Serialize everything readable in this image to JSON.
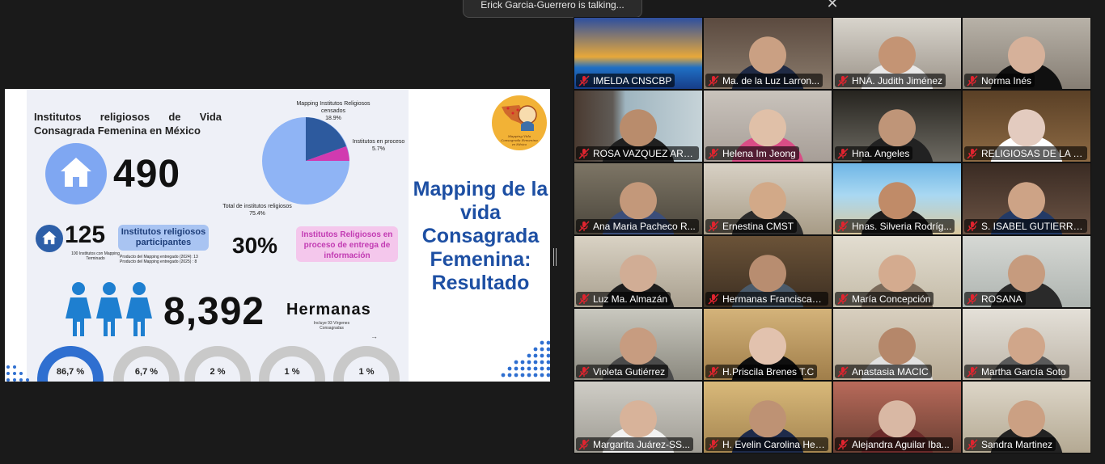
{
  "toast": {
    "text": "Erick Garcia-Guerrero is talking..."
  },
  "share": {
    "title": "Institutos religiosos de Vida Consagrada Femenina en México",
    "total": "490",
    "participants_count": "125",
    "participants_note": "100 Institutos con Mapping Terminado",
    "participants_label": "Institutos religiosos participantes",
    "product_2024": "Producto del Mapping entregado (2024): 13",
    "product_2025": "Producto del Mapping entregado (2025) : 8",
    "pct": "30%",
    "pending_label": "Institutos Religiosos en proceso de entrega de información",
    "sisters": "8,392",
    "sisters_label": "Hermanas",
    "sisters_note": "Incluye 93 Vírgenes Consagradas",
    "pie": {
      "censados_label": "Mapping Institutos Religiosos censados",
      "censados_pct": "18.9%",
      "proceso_label": "Institutos en proceso",
      "proceso_pct": "5.7%",
      "total_label": "Total de institutos religiosos",
      "total_pct": "75.4%"
    },
    "gauges": [
      "86,7 %",
      "6,7 %",
      "2 %",
      "1 %",
      "1 %"
    ],
    "right_title": "Mapping de la vida Consagrada Femenina: Resultado",
    "logo_text": "Mapping Vida Consagrada Femenina en México",
    "colors": {
      "title_blue": "#1d4fa3",
      "accent_blue": "#7fa7f2",
      "pink": "#c23bb3"
    }
  },
  "participants": [
    "IMELDA CNSCBP",
    "Ma. de la Luz Larron...",
    "HNA. Judith Jiménez",
    "Norma Inés",
    "ROSA VAZQUEZ ARC...",
    "Helena Im Jeong",
    "Hna. Angeles",
    "RELIGIOSAS DE LA CR...",
    "Ana Maria Pacheco R...",
    "Ernestina CMST",
    "Hnas. Silveria Rodríg...",
    "S. ISABEL GUTIERREZ",
    "Luz Ma. Almazán",
    "Hermanas Franciscan...",
    "María Concepción",
    "ROSANA",
    "Violeta Gutiérrez",
    "H.Priscila Brenes T.C",
    "Anastasia MACIC",
    "Martha García Soto",
    "Margarita Juárez-SS...",
    "H. Evelin Carolina Her...",
    "Alejandra Aguilar Iba...",
    "Sandra Martinez"
  ]
}
